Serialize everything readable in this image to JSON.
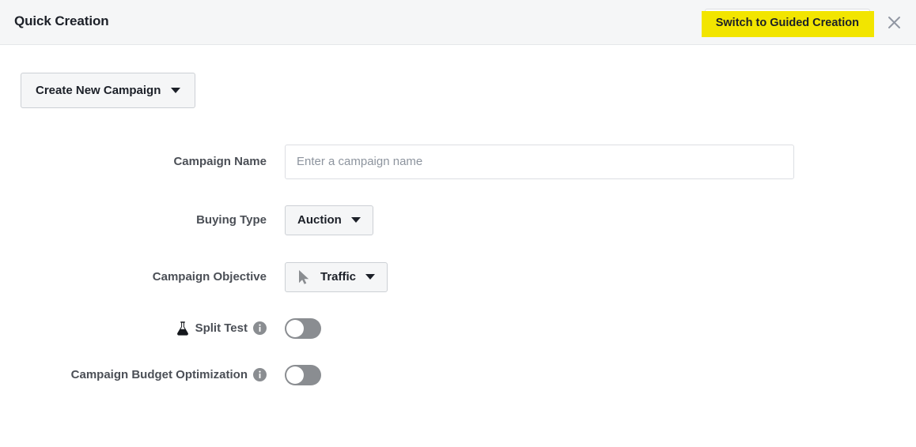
{
  "header": {
    "title": "Quick Creation",
    "switch_button_label": "Switch to Guided Creation",
    "switch_button_highlight_color": "#f2e500",
    "close_icon": "close-icon",
    "background_color": "#f5f6f7"
  },
  "toolbar": {
    "create_campaign_label": "Create New Campaign",
    "caret_icon": "chevron-down-icon"
  },
  "form": {
    "campaign_name": {
      "label": "Campaign Name",
      "value": "",
      "placeholder": "Enter a campaign name"
    },
    "buying_type": {
      "label": "Buying Type",
      "value": "Auction",
      "caret_icon": "chevron-down-icon"
    },
    "campaign_objective": {
      "label": "Campaign Objective",
      "value": "Traffic",
      "leading_icon": "cursor-arrow-icon",
      "caret_icon": "chevron-down-icon"
    },
    "split_test": {
      "label": "Split Test",
      "leading_icon": "flask-icon",
      "info_icon": "info-icon",
      "toggle_state": "off"
    },
    "campaign_budget_optimization": {
      "label": "Campaign Budget Optimization",
      "info_icon": "info-icon",
      "toggle_state": "off"
    }
  }
}
